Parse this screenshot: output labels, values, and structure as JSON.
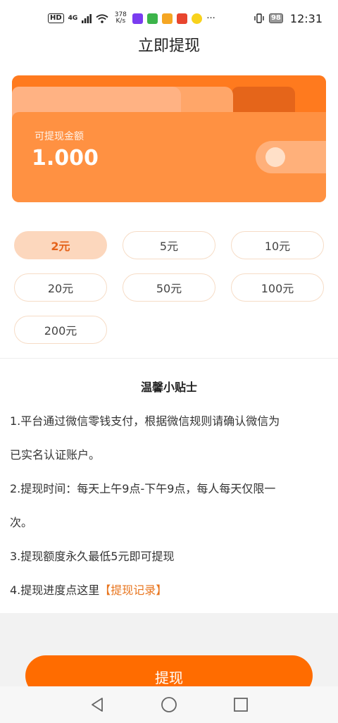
{
  "status_bar": {
    "hd": "HD",
    "network": "4G",
    "speed_top": "378",
    "speed_bottom": "K/s",
    "more": "···",
    "battery": "98",
    "time": "12:31"
  },
  "header": {
    "title": "立即提现"
  },
  "card": {
    "label": "可提现金额",
    "amount": "1.000",
    "colors": {
      "primary": "#ff9142",
      "dark": "#e5651a",
      "light": "#ffb283"
    }
  },
  "options": [
    {
      "label": "2元",
      "selected": true
    },
    {
      "label": "5元",
      "selected": false
    },
    {
      "label": "10元",
      "selected": false
    },
    {
      "label": "20元",
      "selected": false
    },
    {
      "label": "50元",
      "selected": false
    },
    {
      "label": "100元",
      "selected": false
    },
    {
      "label": "200元",
      "selected": false
    }
  ],
  "tips": {
    "title": "温馨小贴士",
    "line1a": "1.平台通过微信零钱支付，根据微信规则请确认微信为",
    "line1b": "已实名认证账户。",
    "line2a": "2.提现时间：每天上午9点-下午9点，每人每天仅限一",
    "line2b": "次。",
    "line3": "3.提现额度永久最低5元即可提现",
    "line4_prefix": "4.提现进度点这里",
    "line4_link": "【提现记录】"
  },
  "submit": {
    "label": "提现",
    "color": "#ff6c00"
  },
  "nav": {
    "back_icon": "back-triangle-icon",
    "home_icon": "home-circle-icon",
    "recent_icon": "recent-square-icon"
  }
}
